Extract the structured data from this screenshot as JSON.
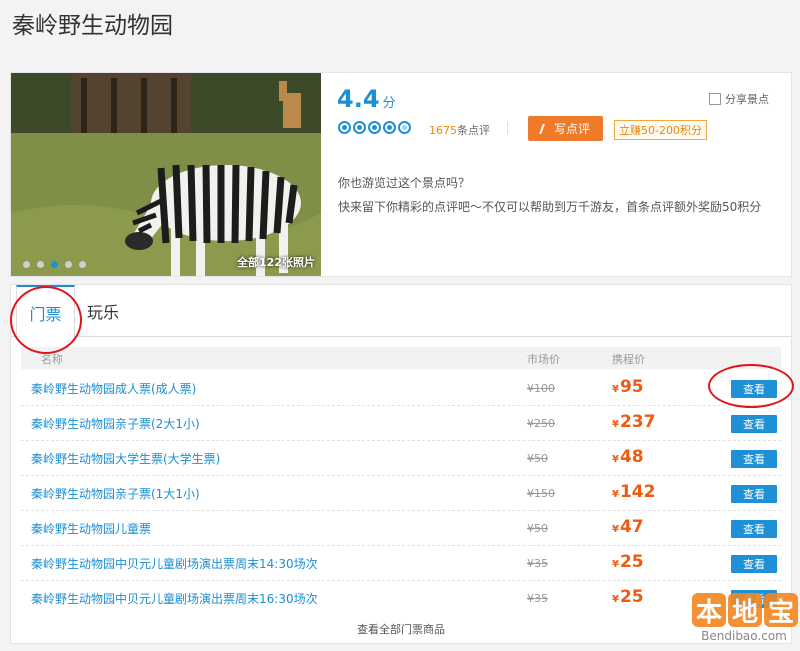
{
  "page": {
    "title": "秦岭野生动物园"
  },
  "summary": {
    "photo_count": "全部122张照片",
    "carousel": {
      "dots": 5,
      "active_index": 2
    },
    "rating": "4.4",
    "rating_unit": "分",
    "share_label": "分享景点",
    "stars": 4.4,
    "review_count_num": "1675",
    "review_count_suffix": "条点评",
    "write_review_label": "写点评",
    "bonus_label": "立赚50-200积分",
    "ask": "你也游览过这个景点吗？",
    "promo": "快来留下你精彩的点评吧～不仅可以帮助到万千游友，首条点评额外奖励50积分",
    "accent_color": "#1a8fd3",
    "orange_color": "#ef7a2a"
  },
  "tabs": [
    {
      "label": "门票",
      "active": true
    },
    {
      "label": "玩乐",
      "active": false
    }
  ],
  "table": {
    "headers": {
      "name": "名称",
      "market": "市场价",
      "price": "携程价"
    },
    "rows": [
      {
        "name": "秦岭野生动物园成人票(成人票)",
        "market_price": "¥100",
        "price": "95",
        "action": "查看"
      },
      {
        "name": "秦岭野生动物园亲子票(2大1小)",
        "market_price": "¥250",
        "price": "237",
        "action": "查看"
      },
      {
        "name": "秦岭野生动物园大学生票(大学生票)",
        "market_price": "¥50",
        "price": "48",
        "action": "查看"
      },
      {
        "name": "秦岭野生动物园亲子票(1大1小)",
        "market_price": "¥150",
        "price": "142",
        "action": "查看"
      },
      {
        "name": "秦岭野生动物园儿童票",
        "market_price": "¥50",
        "price": "47",
        "action": "查看"
      },
      {
        "name": "秦岭野生动物园中贝元儿童剧场演出票周末14:30场次",
        "market_price": "¥35",
        "price": "25",
        "action": "查看"
      },
      {
        "name": "秦岭野生动物园中贝元儿童剧场演出票周末16:30场次",
        "market_price": "¥35",
        "price": "25",
        "action": "查看"
      }
    ],
    "currency": "¥",
    "view_all": "查看全部门票商品"
  },
  "watermark": {
    "chars": [
      "本",
      "地",
      "宝"
    ],
    "url": "Bendibao.com"
  }
}
